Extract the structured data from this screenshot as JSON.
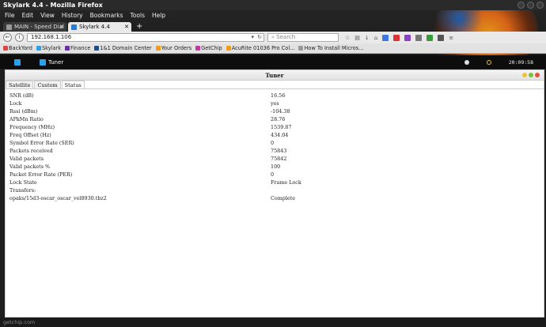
{
  "window": {
    "title": "Skylark 4.4 - Mozilla Firefox"
  },
  "menu": [
    "File",
    "Edit",
    "View",
    "History",
    "Bookmarks",
    "Tools",
    "Help"
  ],
  "tabs": [
    {
      "label": "MAIN - Speed Dial",
      "active": false
    },
    {
      "label": "Skylark 4.4",
      "active": true
    }
  ],
  "nav": {
    "url": "192.168.1.106",
    "search_placeholder": "Search"
  },
  "bookmarks": [
    "BackYard",
    "Skylark",
    "Finance",
    "1&1 Domain Center",
    "Your Orders",
    "GetChip",
    "AcuRite 01036 Pro Col...",
    "How To Install Micros..."
  ],
  "app": {
    "title": "Tuner",
    "clock": "20:09:58"
  },
  "panel": {
    "title": "Tuner",
    "tabs": [
      "Satellite",
      "Custom",
      "Status"
    ],
    "active_tab": "Status",
    "rows": [
      {
        "key": "SNR (dB)",
        "value": "16.56"
      },
      {
        "key": "Lock",
        "value": "yes"
      },
      {
        "key": "Rssi (dBm)",
        "value": "-104.38"
      },
      {
        "key": "APkMn Ratio",
        "value": "28.76"
      },
      {
        "key": "Frequency (MHz)",
        "value": "1539.87"
      },
      {
        "key": "Freq Offset (Hz)",
        "value": "434.04"
      },
      {
        "key": "Symbol Error Rate (SER)",
        "value": "0"
      },
      {
        "key": "Packets received",
        "value": "75843"
      },
      {
        "key": "Valid packets",
        "value": "75842"
      },
      {
        "key": "Valid packets %",
        "value": "100"
      },
      {
        "key": "Packet Error Rate (PER)",
        "value": "0"
      },
      {
        "key": "Lock State",
        "value": "Frame Lock"
      },
      {
        "key": "Transfers:",
        "value": ""
      },
      {
        "key": "opaks/15d3-oscar_oscar_vel8930.tbz2",
        "value": "Complete"
      }
    ]
  },
  "status": {
    "text": "getchip.com"
  },
  "colors": {
    "dot_yellow": "#f0c23b",
    "dot_green": "#7bbf3a",
    "dot_red": "#e0533d",
    "accent": "#2ea0e8"
  }
}
